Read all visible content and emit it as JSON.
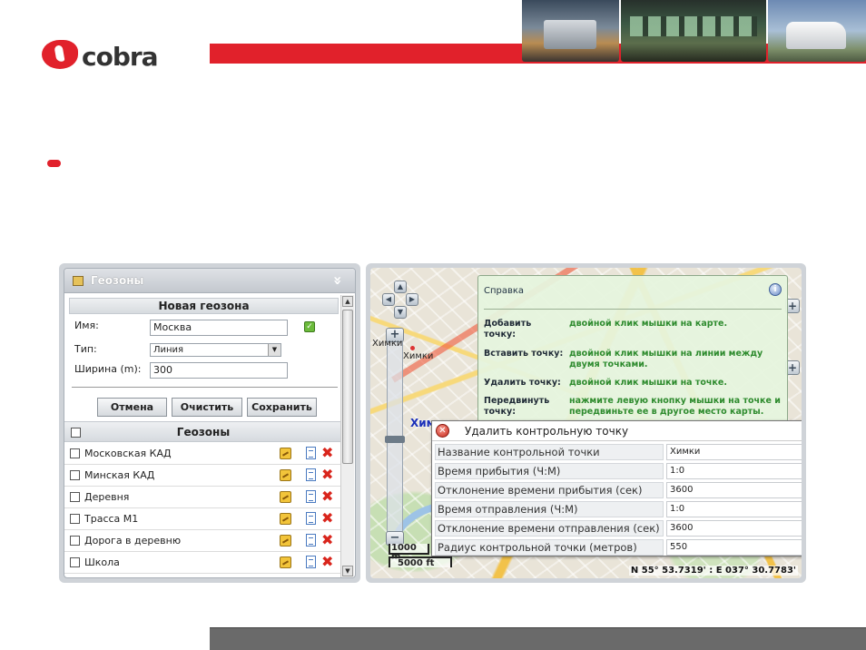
{
  "brand": {
    "name": "cobra",
    "accent": "#e1212b"
  },
  "left_panel": {
    "title": "Геозоны",
    "new_geozone": {
      "heading": "Новая геозона",
      "name_label": "Имя:",
      "name_value": "Москва",
      "type_label": "Тип:",
      "type_value": "Линия",
      "width_label": "Ширина (m):",
      "width_value": "300",
      "buttons": {
        "cancel": "Отмена",
        "clear": "Очистить",
        "save": "Сохранить"
      }
    },
    "list": {
      "heading": "Геозоны",
      "items": [
        {
          "label": "Московская КАД"
        },
        {
          "label": "Минская КАД"
        },
        {
          "label": "Деревня"
        },
        {
          "label": "Трасса М1"
        },
        {
          "label": "Дорога в деревню"
        },
        {
          "label": "Школа"
        }
      ]
    }
  },
  "map": {
    "labels": {
      "city": "Химки",
      "city_small": "Химки",
      "marker": "Химки"
    },
    "scale": {
      "metric": "1000 m",
      "imperial": "5000 ft"
    },
    "coordinates": "N 55° 53.7319' : E 037° 30.7783'",
    "help": {
      "title": "Справка",
      "rows": [
        {
          "key": "Добавить точку:",
          "value": "двойной клик мышки на карте."
        },
        {
          "key": "Вставить точку:",
          "value": "двойной клик мышки на линии между двумя точками."
        },
        {
          "key": "Удалить точку:",
          "value": "двойной клик мышки на точке."
        },
        {
          "key": "Передвинуть точку:",
          "value": "нажмите левую кнопку мышки на точке и передвиньте ее в другое место карты."
        }
      ]
    },
    "dialog": {
      "title": "Удалить контрольную точку",
      "rows": [
        {
          "key": "Название контрольной точки",
          "value": "Химки"
        },
        {
          "key": "Время прибытия (Ч:М)",
          "value": "1:0"
        },
        {
          "key": "Отклонение времени прибытия (сек)",
          "value": "3600"
        },
        {
          "key": "Время отправления (Ч:М)",
          "value": "1:0"
        },
        {
          "key": "Отклонение времени отправления (сек)",
          "value": "3600"
        },
        {
          "key": "Радиус контрольной точки (метров)",
          "value": "550"
        }
      ]
    }
  }
}
